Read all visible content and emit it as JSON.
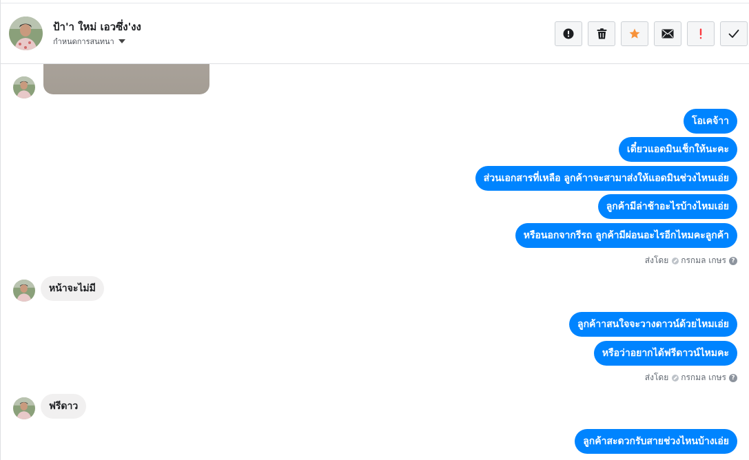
{
  "header": {
    "contact_name": "ป้า'า ใหม่ เอวซึ่ง'งง",
    "assign_label": "กำหนดการสนทนา",
    "toolbar": [
      {
        "name": "spam-button",
        "icon": "alert-circle-icon"
      },
      {
        "name": "delete-button",
        "icon": "trash-icon"
      },
      {
        "name": "follow-up-button",
        "icon": "star-icon"
      },
      {
        "name": "mark-unread-button",
        "icon": "envelope-icon"
      },
      {
        "name": "priority-button",
        "icon": "exclamation-icon"
      },
      {
        "name": "mark-done-button",
        "icon": "checkmark-icon"
      }
    ]
  },
  "colors": {
    "outgoing_bubble": "#0084ff",
    "incoming_bubble": "#f1f0f0",
    "star": "#f7923a",
    "priority": "#fa383e"
  },
  "messages": {
    "out_group_1": [
      "โอเคจ้าา",
      "เดี๋ยวแอดมินเช็กให้นะคะ",
      "ส่วนเอกสารที่เหลือ ลูกค้าาจะสามาส่งให้แอดมินช่วงไหนเอ่ย",
      "ลูกค้ามีล่าช้าอะไรบ้างไหมเอ่ย",
      "หรือนอกจากรีรถ ลูกค้ามีผ่อนอะไรอีกไหมคะลูกค้า"
    ],
    "sent_by_1": {
      "prefix": "ส่งโดย",
      "name": "กรกมล เกษร",
      "help": "?"
    },
    "in_1": "หน้าจะไม่มี",
    "out_group_2": [
      "ลูกค้าาสนใจจะวางดาวน์ด้วยไหมเอ่ย",
      "หรือว่าอยากได้ฟรีดาวน์ไหมคะ"
    ],
    "sent_by_2": {
      "prefix": "ส่งโดย",
      "name": "กรกมล เกษร",
      "help": "?"
    },
    "in_2": "ฟรีดาว",
    "out_group_3": [
      "ลูกค้าสะดวกรับสายช่วงไหนบ้างเอ่ย"
    ]
  }
}
